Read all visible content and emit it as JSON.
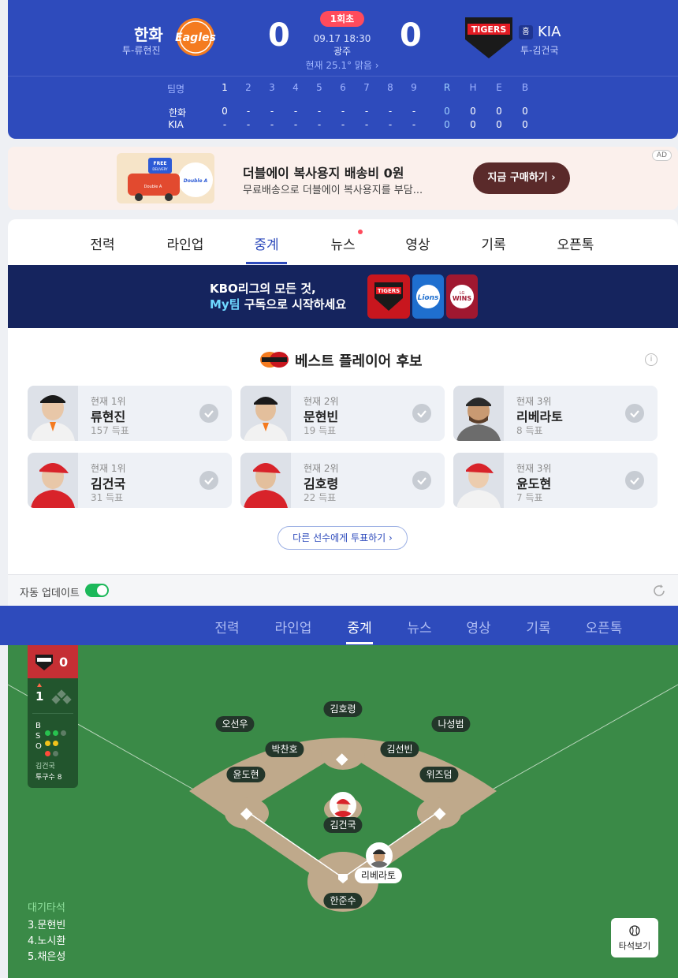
{
  "scoreboard": {
    "away_team": "한화",
    "away_pitcher": "투-류현진",
    "away_logo": "Eagles",
    "away_score": "0",
    "home_team": "KIA",
    "home_badge": "홈",
    "home_pitcher": "투-김건국",
    "home_logo": "TIGERS",
    "home_score": "0",
    "inning": "1회초",
    "datetime": "09.17 18:30",
    "stadium": "광주",
    "weather": "현재 25.1° 맑음 ›",
    "box": {
      "head_label": "팀명",
      "innings": [
        "1",
        "2",
        "3",
        "4",
        "5",
        "6",
        "7",
        "8",
        "9"
      ],
      "rheb": [
        "R",
        "H",
        "E",
        "B"
      ],
      "rows": [
        {
          "team": "한화",
          "innings": [
            "0",
            "-",
            "-",
            "-",
            "-",
            "-",
            "-",
            "-",
            "-"
          ],
          "rheb": [
            "0",
            "0",
            "0",
            "0"
          ]
        },
        {
          "team": "KIA",
          "innings": [
            "-",
            "-",
            "-",
            "-",
            "-",
            "-",
            "-",
            "-",
            "-"
          ],
          "rheb": [
            "0",
            "0",
            "0",
            "0"
          ]
        }
      ]
    }
  },
  "ad": {
    "title": "더블에이 복사용지 배송비 0원",
    "subtitle": "무료배송으로 더블에이 복사용지를 부담...",
    "button": "지금 구매하기 ›",
    "tag": "AD",
    "image_text_1": "FREE",
    "image_text_2": "DELIVERY",
    "image_text_3": "Double A"
  },
  "tabs": [
    "전력",
    "라인업",
    "중계",
    "뉴스",
    "영상",
    "기록",
    "오픈톡"
  ],
  "active_tab": "중계",
  "banner": {
    "line1": "KBO리그의 모든 것,",
    "line2_hl": "My팀",
    "line2_rest": " 구독으로 시작하세요",
    "logos": [
      "TIGERS",
      "Lions",
      "WINS"
    ],
    "logo_small": "LG"
  },
  "best_player": {
    "title": "베스트 플레이어 후보",
    "vote_button": "다른 선수에게 투표하기 ›",
    "cards": [
      {
        "rank": "현재 1위",
        "name": "류현진",
        "votes": "157 득표",
        "team": "eagles"
      },
      {
        "rank": "현재 2위",
        "name": "문현빈",
        "votes": "19 득표",
        "team": "eagles"
      },
      {
        "rank": "현재 3위",
        "name": "리베라토",
        "votes": "8 득표",
        "team": "eagles"
      },
      {
        "rank": "현재 1위",
        "name": "김건국",
        "votes": "31 득표",
        "team": "tigers"
      },
      {
        "rank": "현재 2위",
        "name": "김호령",
        "votes": "22 득표",
        "team": "tigers"
      },
      {
        "rank": "현재 3위",
        "name": "윤도현",
        "votes": "7 득표",
        "team": "tigers"
      }
    ]
  },
  "auto_update": {
    "label": "자동 업데이트",
    "on": true
  },
  "field": {
    "score": "0",
    "inning": "1",
    "count_labels": [
      "B",
      "S",
      "O"
    ],
    "balls": 2,
    "strikes": 2,
    "outs": 1,
    "pitcher_name": "김건국",
    "pitch_count": "투구수 8",
    "fielders": [
      {
        "name": "김호령",
        "pos": "cf"
      },
      {
        "name": "오선우",
        "pos": "lf"
      },
      {
        "name": "나성범",
        "pos": "rf"
      },
      {
        "name": "박찬호",
        "pos": "ss"
      },
      {
        "name": "김선빈",
        "pos": "2b"
      },
      {
        "name": "윤도현",
        "pos": "3b"
      },
      {
        "name": "위즈덤",
        "pos": "1b"
      },
      {
        "name": "한준수",
        "pos": "c"
      }
    ],
    "pitcher_label": "김건국",
    "batter_label": "리베라토",
    "on_deck_title": "대기타석",
    "on_deck": [
      "3.문현빈",
      "4.노시환",
      "5.채은성"
    ],
    "view_button": "타석보기"
  },
  "colors": {
    "primary": "#2e4bbc",
    "accent_red": "#ff4b5c",
    "field_green": "#3a8a47",
    "infield": "#bfa98b",
    "toggle_on": "#1cb85a"
  }
}
